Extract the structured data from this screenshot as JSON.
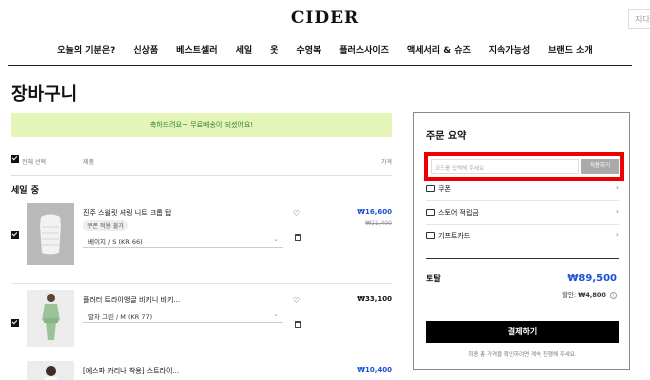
{
  "header": {
    "logo": "CIDER",
    "search_cut": "지다"
  },
  "nav": [
    "오늘의 기분은?",
    "신상품",
    "베스트셀러",
    "세일",
    "옷",
    "수영복",
    "플러스사이즈",
    "액세서리 & 슈즈",
    "지속가능성",
    "브랜드 소개"
  ],
  "page_title": "장바구니",
  "banner": "축하드려요~ 무료배송이 되셨어요!",
  "list_header": {
    "select_all": "전체 선택",
    "product": "제품",
    "price": "가격"
  },
  "section_title": "세일 중",
  "items": [
    {
      "name": "진주 스윌릿 셔링 니트 크롭 탑",
      "badge": "쿠폰 적용 불가",
      "option": "베이지 / S (KR 66)",
      "sale_price": "₩16,600",
      "original_price": "₩21,400",
      "checked": true
    },
    {
      "name": "플러터 트라이앵글 비키니 비키...",
      "option": "말차 그린 / M (KR 77)",
      "price": "₩33,100",
      "checked": true
    },
    {
      "name": "[에스파 카리나 착용] 스트라이...",
      "price": "₩10,400"
    }
  ],
  "summary": {
    "title": "주문 요약",
    "coupon_placeholder": "코드를 입력해 주세요",
    "coupon_button": "적용하기",
    "rows": [
      {
        "icon": "coupon-icon",
        "label": "쿠폰"
      },
      {
        "icon": "wallet-icon",
        "label": "스토어 적립금"
      },
      {
        "icon": "gift-card-icon",
        "label": "기프트카드"
      }
    ],
    "total_label": "토탈",
    "total_value": "₩89,500",
    "discount_label": "할인:",
    "discount_value": "₩4,800",
    "checkout_button": "결제하기",
    "note": "최종 총 가격을 확인하려면 계속 진행해 주세요."
  },
  "colors": {
    "accent_blue": "#1a4fd6",
    "banner_bg": "#e4f5b7",
    "highlight_red": "#e00000"
  }
}
